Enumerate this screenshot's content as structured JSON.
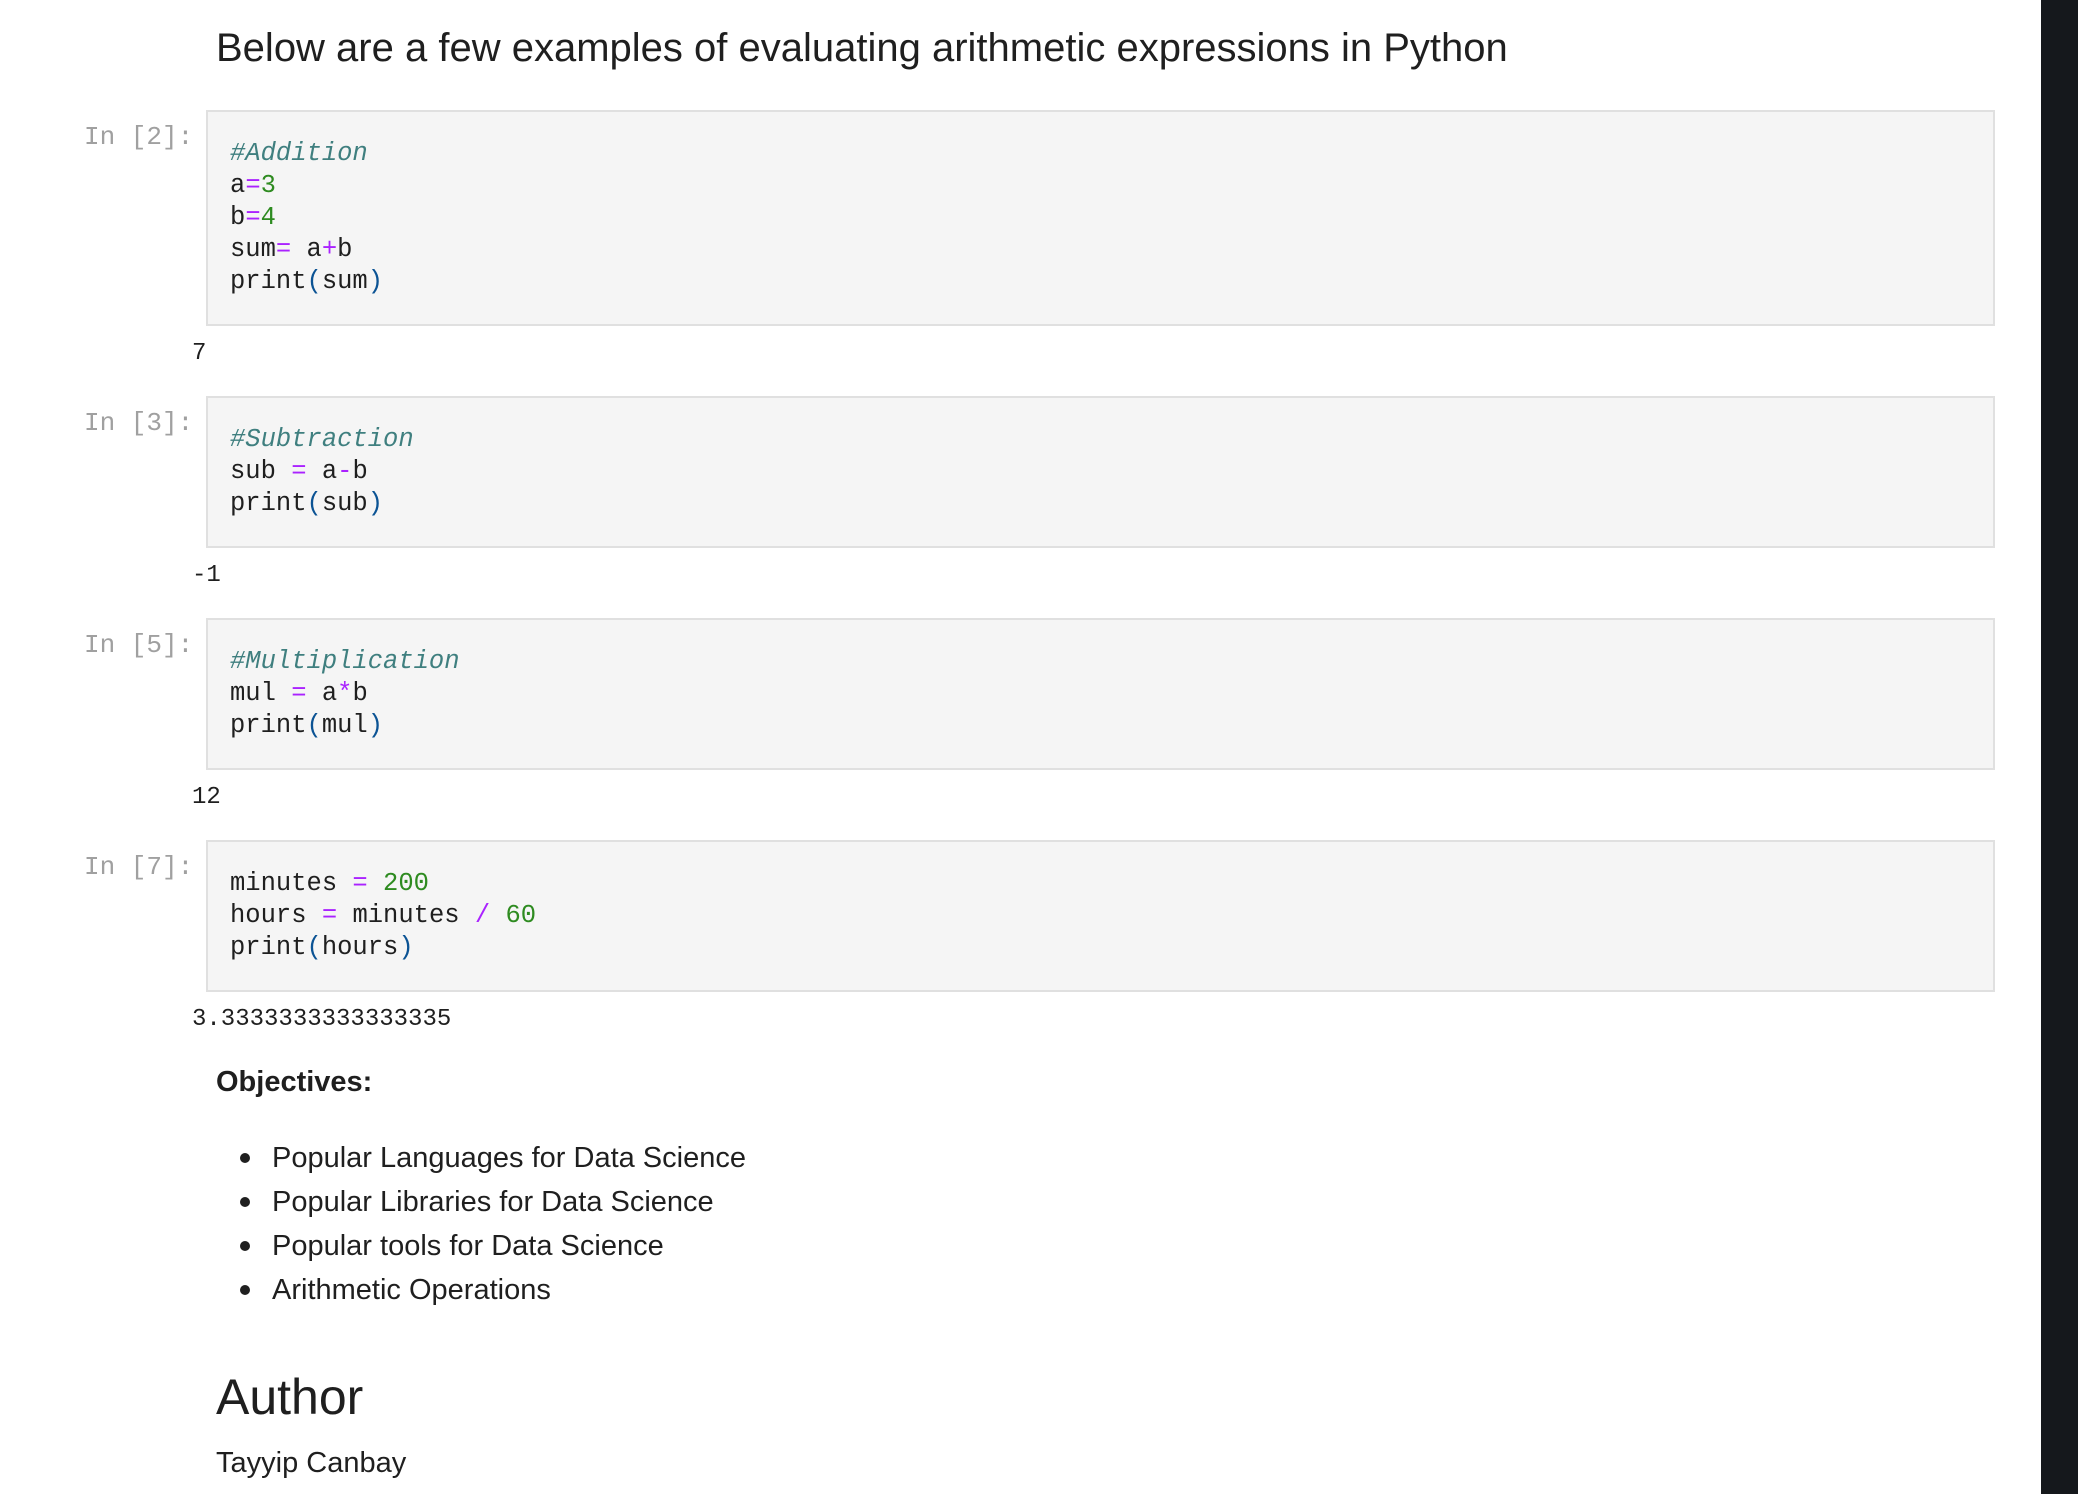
{
  "heading": "Below are a few examples of evaluating arithmetic expressions in Python",
  "cells": [
    {
      "prompt": "In [2]:",
      "code_lines": [
        [
          {
            "t": "#Addition",
            "c": "cm"
          }
        ],
        [
          {
            "t": "a",
            "c": ""
          },
          {
            "t": "=",
            "c": "op"
          },
          {
            "t": "3",
            "c": "num"
          }
        ],
        [
          {
            "t": "b",
            "c": ""
          },
          {
            "t": "=",
            "c": "op"
          },
          {
            "t": "4",
            "c": "num"
          }
        ],
        [
          {
            "t": "sum",
            "c": ""
          },
          {
            "t": "=",
            "c": "op"
          },
          {
            "t": " a",
            "c": ""
          },
          {
            "t": "+",
            "c": "op"
          },
          {
            "t": "b",
            "c": ""
          }
        ],
        [
          {
            "t": "print",
            "c": ""
          },
          {
            "t": "(",
            "c": "par"
          },
          {
            "t": "sum",
            "c": ""
          },
          {
            "t": ")",
            "c": "par"
          }
        ]
      ],
      "output": "7"
    },
    {
      "prompt": "In [3]:",
      "code_lines": [
        [
          {
            "t": "#Subtraction",
            "c": "cm"
          }
        ],
        [
          {
            "t": "sub ",
            "c": ""
          },
          {
            "t": "=",
            "c": "op"
          },
          {
            "t": " a",
            "c": ""
          },
          {
            "t": "-",
            "c": "op"
          },
          {
            "t": "b",
            "c": ""
          }
        ],
        [
          {
            "t": "print",
            "c": ""
          },
          {
            "t": "(",
            "c": "par"
          },
          {
            "t": "sub",
            "c": ""
          },
          {
            "t": ")",
            "c": "par"
          }
        ]
      ],
      "output": "-1"
    },
    {
      "prompt": "In [5]:",
      "code_lines": [
        [
          {
            "t": "#Multiplication",
            "c": "cm"
          }
        ],
        [
          {
            "t": "mul ",
            "c": ""
          },
          {
            "t": "=",
            "c": "op"
          },
          {
            "t": " a",
            "c": ""
          },
          {
            "t": "*",
            "c": "op"
          },
          {
            "t": "b",
            "c": ""
          }
        ],
        [
          {
            "t": "print",
            "c": ""
          },
          {
            "t": "(",
            "c": "par"
          },
          {
            "t": "mul",
            "c": ""
          },
          {
            "t": ")",
            "c": "par"
          }
        ]
      ],
      "output": "12"
    },
    {
      "prompt": "In [7]:",
      "code_lines": [
        [
          {
            "t": "minutes ",
            "c": ""
          },
          {
            "t": "=",
            "c": "op"
          },
          {
            "t": " ",
            "c": ""
          },
          {
            "t": "200",
            "c": "num"
          }
        ],
        [
          {
            "t": "hours ",
            "c": ""
          },
          {
            "t": "=",
            "c": "op"
          },
          {
            "t": " minutes ",
            "c": ""
          },
          {
            "t": "/",
            "c": "op"
          },
          {
            "t": " ",
            "c": ""
          },
          {
            "t": "60",
            "c": "num"
          }
        ],
        [
          {
            "t": "print",
            "c": ""
          },
          {
            "t": "(",
            "c": "par"
          },
          {
            "t": "hours",
            "c": ""
          },
          {
            "t": ")",
            "c": "par"
          }
        ]
      ],
      "output": "3.3333333333333335"
    }
  ],
  "objectives": {
    "title": "Objectives:",
    "items": [
      "Popular Languages for Data Science",
      "Popular Libraries for Data Science",
      "Popular tools for Data Science",
      "Arithmetic Operations"
    ]
  },
  "author": {
    "heading": "Author",
    "name": "Tayyip Canbay"
  },
  "colors": {
    "comment": "#3f7f7f",
    "operator": "#aa22ff",
    "number": "#2e8b20",
    "paren": "#0b5394",
    "prompt": "#a0a0a0",
    "cell_bg": "#f5f5f5",
    "side_bar": "#15181c"
  }
}
